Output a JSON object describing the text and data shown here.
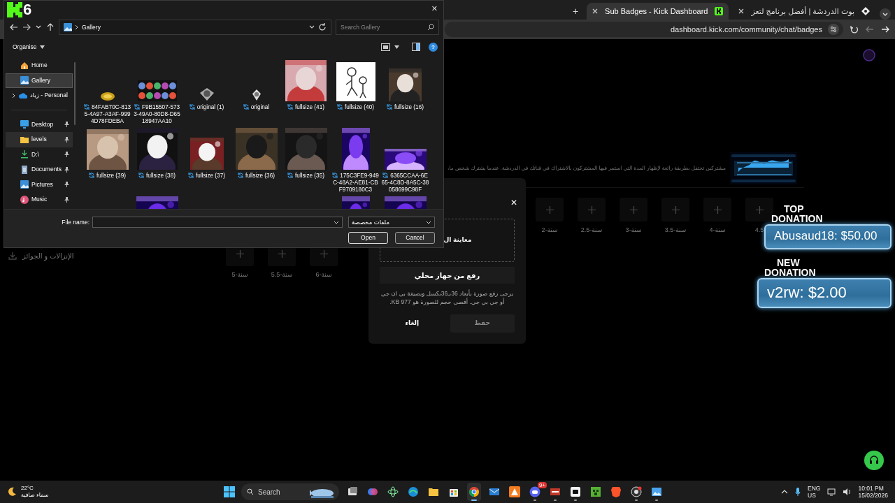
{
  "overlay_logo": {
    "text": "6"
  },
  "browser": {
    "new_tab": "+",
    "tabs": [
      {
        "title": "Sub Badges - Kick Dashboard",
        "selected": true
      },
      {
        "title": "بوت الدردشة | أفضل برنامج لتعز",
        "selected": false
      }
    ],
    "address": "dashboard.kick.com/community/chat/badges"
  },
  "dashboard": {
    "description": "مشتركين تحتفل بطريقة رائعة لإظهار المدة التي استمر فيها المشتركون بالاشتراك في قناتك في الدردشة. عندما يشترك شخص ما،",
    "badge_slots": [
      {
        "label": "4.5"
      },
      {
        "label": "4-سنة"
      },
      {
        "label": "3.5-سنة"
      },
      {
        "label": "3-سنة"
      },
      {
        "label": "2.5-سنة"
      },
      {
        "label": "2-سنة"
      }
    ],
    "sidebar_item": "الإنزالات و الجوائز",
    "badge_slots_row2": [
      {
        "label": "6-سنة"
      },
      {
        "label": "5.5-سنة"
      },
      {
        "label": "5-سنة"
      }
    ]
  },
  "upload_modal": {
    "close": "✕",
    "preview": "معاينة ال",
    "upload_button": "رفع من جهاز محلي",
    "help": "يرجى رفع صورة بأبعاد 36بـ36بكسل وبصيغة بي ان جي أو جي بي جي. أقصى حجم للصورة هو 977 KB.",
    "cancel": "إلغاء",
    "save": {
      "label": "حفظ",
      "disabled": true
    }
  },
  "donations": [
    {
      "line_1": "TOP",
      "line_2": "DONATION",
      "text": "Abusaud18: $50.00"
    },
    {
      "line_1": "NEW",
      "line_2": "DONATION",
      "text": "v2rw: $2.00"
    }
  ],
  "file_dialog": {
    "close": "✕",
    "path": "Gallery",
    "search": {
      "placeholder": "Search Gallery"
    },
    "organise": "Organise",
    "help": "?",
    "sidebar_top": [
      {
        "label": "Home",
        "selected": false,
        "hovered": false,
        "expandable": false
      },
      {
        "label": "Gallery",
        "selected": true,
        "hovered": false,
        "expandable": false
      },
      {
        "label": "زياد - Personal",
        "selected": false,
        "hovered": false,
        "expandable": true
      }
    ],
    "sidebar_quick": [
      {
        "label": "Desktop",
        "selected": false,
        "hovered": false,
        "pinned": true
      },
      {
        "label": "levels",
        "selected": false,
        "hovered": true,
        "pinned": true
      },
      {
        "label": "D:\\",
        "selected": false,
        "hovered": false,
        "pinned": true
      },
      {
        "label": "Documents",
        "selected": false,
        "hovered": false,
        "pinned": true
      },
      {
        "label": "Pictures",
        "selected": false,
        "hovered": false,
        "pinned": true
      },
      {
        "label": "Music",
        "selected": false,
        "hovered": false,
        "pinned": true
      }
    ],
    "files": [
      {
        "kind": "picture",
        "label": "84FAB70C-8135-4A97-A3AF-9994D78FDEBA",
        "sync": true
      },
      {
        "kind": "picture",
        "label": "F9B15507-5733-49A0-80D8-D6518947AA10",
        "sync": true
      },
      {
        "kind": "picture",
        "label": "original (1)",
        "sync": true
      },
      {
        "kind": "picture",
        "label": "original",
        "sync": true
      },
      {
        "kind": "picture",
        "label": "fullsize (41)",
        "sync": true
      },
      {
        "kind": "picture",
        "label": "fullsize (40)",
        "sync": true
      },
      {
        "kind": "picture",
        "label": "fullsize (16)",
        "sync": true
      },
      {
        "kind": "picture",
        "label": "fullsize (39)",
        "sync": true
      },
      {
        "kind": "picture",
        "label": "fullsize (38)",
        "sync": true
      },
      {
        "kind": "picture",
        "label": "fullsize (37)",
        "sync": true
      },
      {
        "kind": "picture",
        "label": "fullsize (36)",
        "sync": true
      },
      {
        "kind": "picture",
        "label": "fullsize (35)",
        "sync": true
      },
      {
        "kind": "picture",
        "label": "175C3FE9-949C-48A2-AE81-CBF9709180C3",
        "sync": true
      },
      {
        "kind": "picture",
        "label": "6365CCAA-6E65-4C8D-8A5C-38058699C98F",
        "sync": true
      },
      {
        "kind": "empty"
      },
      {
        "kind": "picture"
      },
      {
        "kind": "empty"
      },
      {
        "kind": "empty"
      },
      {
        "kind": "empty"
      },
      {
        "kind": "picture"
      },
      {
        "kind": "picture"
      }
    ],
    "file_name_label": "File name:",
    "file_type": "ملفات مخصصة",
    "open": "Open",
    "cancel": "Cancel"
  },
  "taskbar": {
    "weather": {
      "temp": "22°C",
      "condition": "سماء صافية"
    },
    "search": "Search",
    "apps": [
      {
        "open": false,
        "active": false
      },
      {
        "open": false,
        "active": false
      },
      {
        "open": false,
        "active": false
      },
      {
        "open": false,
        "active": false
      },
      {
        "open": false,
        "active": false
      },
      {
        "open": false,
        "active": false
      },
      {
        "open": true,
        "active": true
      },
      {
        "open": false,
        "active": false
      },
      {
        "open": false,
        "active": false
      },
      {
        "open": true,
        "active": false,
        "badge": "9+"
      },
      {
        "open": true,
        "active": false
      },
      {
        "open": true,
        "active": false
      },
      {
        "open": false,
        "active": false
      },
      {
        "open": false,
        "active": false
      },
      {
        "open": true,
        "active": false
      },
      {
        "open": true,
        "active": false
      }
    ],
    "language": "ENG",
    "region": "US",
    "time": "10:01 PM",
    "date": "15/02/2026"
  }
}
